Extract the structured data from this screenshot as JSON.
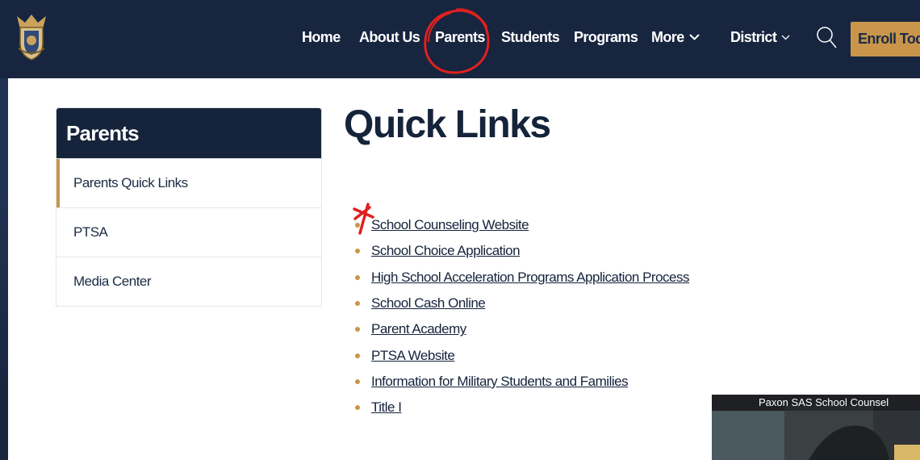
{
  "header": {
    "nav": [
      {
        "label": "Home"
      },
      {
        "label": "About Us"
      },
      {
        "label": "Parents"
      },
      {
        "label": "Students"
      },
      {
        "label": "Programs"
      },
      {
        "label": "More"
      },
      {
        "label": "District"
      }
    ],
    "enroll_label": "Enroll Toda"
  },
  "sidebar": {
    "title": "Parents",
    "items": [
      {
        "label": "Parents Quick Links"
      },
      {
        "label": "PTSA"
      },
      {
        "label": "Media Center"
      }
    ]
  },
  "main": {
    "title": "Quick Links",
    "links": [
      {
        "label": "School Counseling Website"
      },
      {
        "label": "School Choice Application"
      },
      {
        "label": "High School Acceleration Programs Application Process"
      },
      {
        "label": "School Cash Online"
      },
      {
        "label": "Parent Academy"
      },
      {
        "label": "PTSA Website"
      },
      {
        "label": "Information for Military Students and Families"
      },
      {
        "label": "Title I"
      }
    ]
  },
  "video": {
    "title": "Paxon SAS School Counsel"
  },
  "colors": {
    "navy": "#15233b",
    "gold": "#c9954b",
    "annotation_red": "#e02020"
  },
  "icons": [
    "school-crest-logo",
    "search-icon",
    "chevron-down-icon"
  ]
}
